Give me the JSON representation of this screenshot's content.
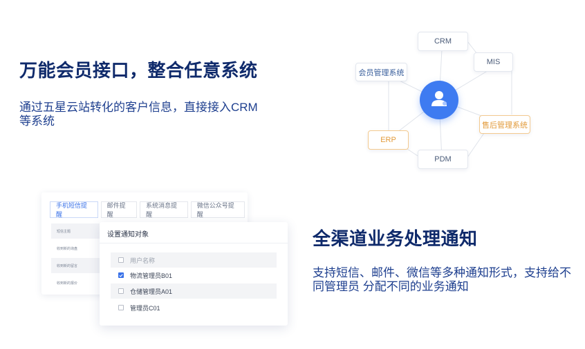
{
  "section1": {
    "title": "万能会员接口，整合任意系统",
    "description": "通过五星云站转化的客户信息，直接接入CRM等系统"
  },
  "diagram": {
    "hub_icon": "user-group-icon",
    "nodes": {
      "crm": "CRM",
      "mis": "MIS",
      "member": "会员管理系统",
      "after_sales": "售后管理系统",
      "erp": "ERP",
      "pdm": "PDM"
    },
    "colors": {
      "hub": "#3e7bf1",
      "highlight": "#e29a39"
    }
  },
  "notify_panel": {
    "tabs": [
      "手机短信提醒",
      "邮件提醒",
      "系统消息提醒",
      "微信公众号提醒"
    ],
    "side_items": [
      "短信主题",
      "收到新的询盘",
      "收到新的留言",
      "收到新的报价"
    ],
    "dialog": {
      "title": "设置通知对象",
      "header": "用户名称",
      "rows": [
        {
          "label": "物流管理员B01",
          "checked": true
        },
        {
          "label": "仓储管理员A01",
          "checked": false
        },
        {
          "label": "管理员C01",
          "checked": false
        }
      ]
    }
  },
  "section2": {
    "title": "全渠道业务处理通知",
    "description": "支持短信、邮件、微信等多种通知形式，支持给不同管理员 分配不同的业务通知"
  }
}
